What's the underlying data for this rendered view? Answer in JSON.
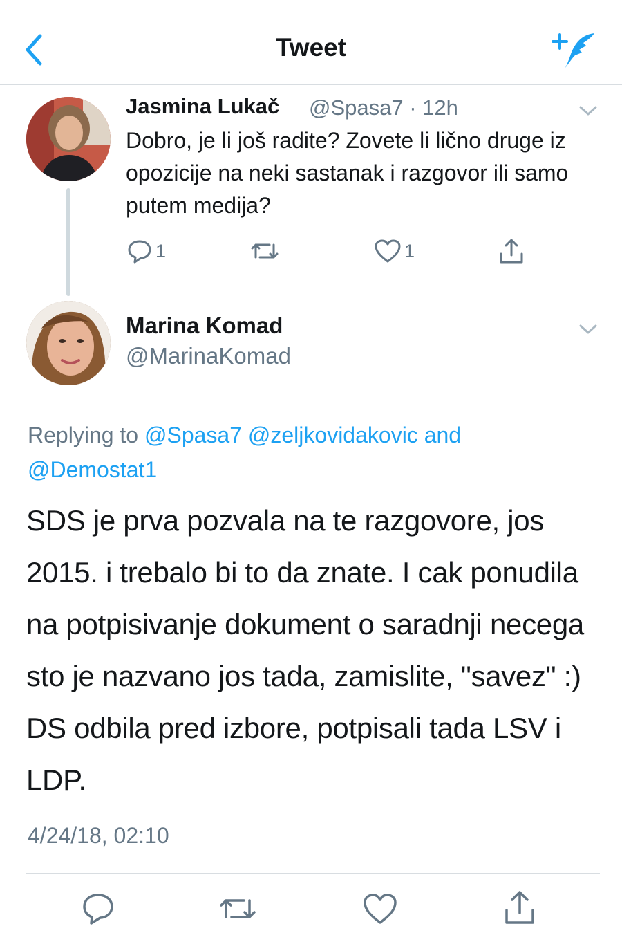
{
  "header": {
    "title": "Tweet",
    "accent_color": "#1da1f2",
    "icons": {
      "back": "chevron-left-icon",
      "compose": "compose-tweet-icon"
    }
  },
  "parent_tweet": {
    "author_name": "Jasmina Lukač",
    "handle_time": "@Spasa7 · 12h",
    "text": "Dobro, je li još radite? Zovete li lično druge iz opozicije na neki sastanak i razgovor ili samo putem medija?",
    "reply_count": "1",
    "like_count": "1"
  },
  "main_tweet": {
    "author_name": "Marina Komad",
    "handle": "@MarinaKomad",
    "replying_prefix": "Replying to ",
    "mention_1": "@Spasa7",
    "mention_2": "@zeljkovidakovic",
    "mention_and": " and",
    "mention_3": "@Demostat1",
    "text": "SDS je prva pozvala na te razgovore, jos 2015. i trebalo bi to da znate. I cak ponudila na potpisivanje dokument o saradnji necega sto je nazvano jos tada, zamislite, \"savez\" :) DS odbila pred izbore, potpisali tada LSV i LDP.",
    "timestamp": "4/24/18, 02:10"
  },
  "colors": {
    "text": "#14171a",
    "secondary": "#657786",
    "link": "#1da1f2",
    "divider": "#d8dde1"
  }
}
